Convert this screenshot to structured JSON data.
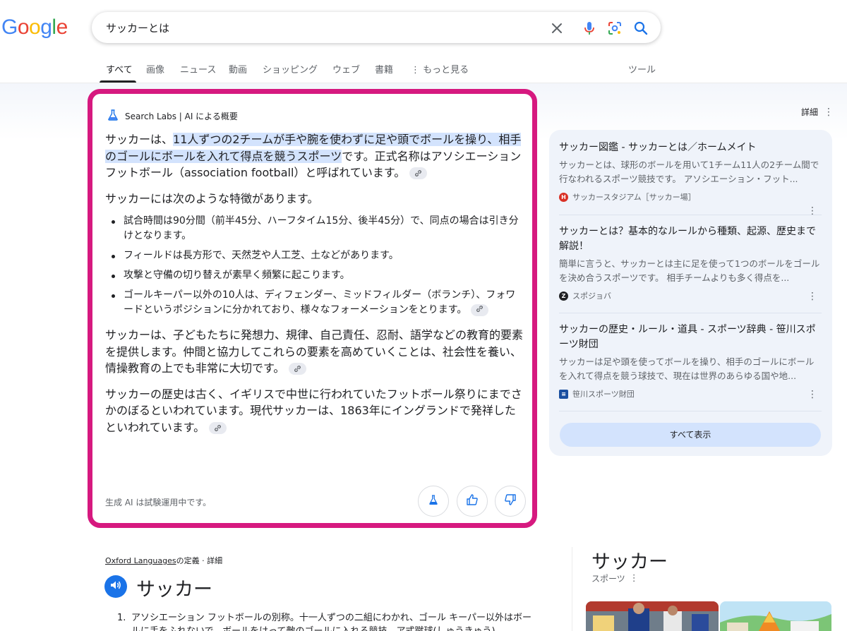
{
  "header": {
    "logo": {
      "text": "Google",
      "colors": [
        "#4285F4",
        "#EA4335",
        "#FBBC05",
        "#4285F4",
        "#34A853",
        "#EA4335"
      ]
    },
    "search": {
      "query": "サッカーとは"
    },
    "tabs": [
      {
        "label": "すべて",
        "active": true
      },
      {
        "label": "画像"
      },
      {
        "label": "ニュース"
      },
      {
        "label": "動画"
      },
      {
        "label": "ショッピング"
      },
      {
        "label": "ウェブ"
      },
      {
        "label": "書籍"
      },
      {
        "label": "もっと見る"
      }
    ],
    "tools_label": "ツール"
  },
  "ai_overview": {
    "header_label": "Search Labs | AI による概要",
    "intro_plain_start": "サッカーは、",
    "intro_highlight": "11人ずつの2チームが手や腕を使わずに足や頭でボールを操り、相手のゴールにボールを入れて得点を競うスポーツ",
    "intro_rest": "です。正式名称はアソシエーションフットボール（association football）と呼ばれています。",
    "features_lead": "サッカーには次のような特徴があります。",
    "features": [
      "試合時間は90分間（前半45分、ハーフタイム15分、後半45分）で、同点の場合は引き分けとなります。",
      "フィールドは長方形で、天然芝や人工芝、土などがあります。",
      "攻撃と守備の切り替えが素早く頻繁に起こります。",
      "ゴールキーパー以外の10人は、ディフェンダー、ミッドフィルダー（ボランチ）、フォワードというポジションに分かれており、様々なフォーメーションをとります。"
    ],
    "paragraph_education": "サッカーは、子どもたちに発想力、規律、自己責任、忍耐、語学などの教育的要素を提供します。仲間と協力してこれらの要素を高めていくことは、社会性を養い、情操教育の上でも非常に大切です。",
    "paragraph_history": "サッカーの歴史は古く、イギリスで中世に行われていたフットボール祭りにまでさかのぼるといわれています。現代サッカーは、1863年にイングランドで発祥したといわれています。",
    "footer_note": "生成 AI は試験運用中です。"
  },
  "right_panel": {
    "detail_label": "詳細",
    "sources": [
      {
        "title": "サッカー図鑑 - サッカーとは／ホームメイト",
        "snippet": "サッカーとは、球形のボールを用いて1チーム11人の2チーム間で行なわれるスポーツ競技です。 アソシエーション・フット...",
        "site": "サッカースタジアム［サッカー場］",
        "favicon_color": "#d93025",
        "favicon_glyph": "H"
      },
      {
        "title": "サッカーとは？基本的なルールから種類、起源、歴史まで解説！",
        "snippet": "簡単に言うと、サッカーとは主に足を使って1つのボールをゴールを決め合うスポーツです。 相手チームよりも多く得点を...",
        "site": "スポジョバ",
        "favicon_color": "#202124",
        "favicon_glyph": "Z"
      },
      {
        "title": "サッカーの歴史・ルール・道具 - スポーツ辞典 - 笹川スポーツ財団",
        "snippet": "サッカーは足や頭を使ってボールを操り、相手のゴールにボールを入れて得点を競う球技で、現在は世界のあらゆる国や地...",
        "site": "笹川スポーツ財団",
        "favicon_color": "#1a4fa0",
        "favicon_glyph": "≡"
      }
    ],
    "show_all_label": "すべて表示"
  },
  "dictionary": {
    "source_name": "Oxford Languages",
    "source_suffix": "の定義 · 詳細",
    "word": "サッカー",
    "definition_number": "1.",
    "definition": "アソシエーション フットボールの別称。十一人ずつの二組にわかれ、ゴール キーパー以外はボールに手をふれないで、ボールをけって敵のゴールに入れる競技。ア式蹴球(しゅうきゅう)。"
  },
  "knowledge_panel": {
    "title": "サッカー",
    "subtitle": "スポーツ"
  }
}
